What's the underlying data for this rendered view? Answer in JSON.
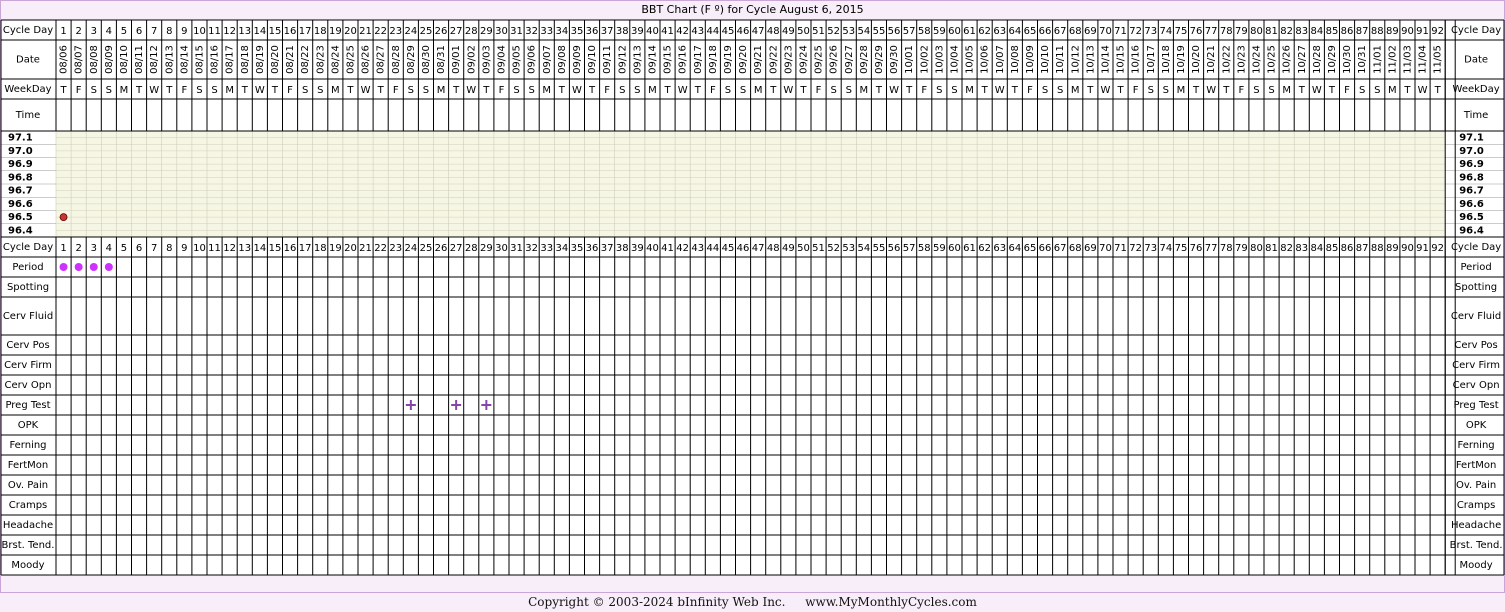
{
  "title": "BBT Chart (F º) for Cycle August 6, 2015",
  "labels": {
    "cycle_day": "Cycle Day",
    "date": "Date",
    "weekday": "WeekDay",
    "time": "Time"
  },
  "symptom_rows": [
    "Period",
    "Spotting",
    "Cerv Fluid",
    "Cerv Pos",
    "Cerv Firm",
    "Cerv Opn",
    "Preg Test",
    "OPK",
    "Ferning",
    "FertMon",
    "Ov. Pain",
    "Cramps",
    "Headache",
    "Brst. Tend.",
    "Moody"
  ],
  "weekdays": [
    "T",
    "F",
    "S",
    "S",
    "M",
    "T",
    "W",
    "T",
    "F",
    "S",
    "S",
    "M",
    "T",
    "W",
    "T",
    "F",
    "S",
    "S",
    "M",
    "T",
    "W",
    "T",
    "F",
    "S",
    "S",
    "M",
    "T",
    "W",
    "T",
    "F",
    "S",
    "S",
    "M",
    "T",
    "W",
    "T",
    "F",
    "S",
    "S",
    "M",
    "T",
    "W",
    "T",
    "F",
    "S",
    "S",
    "M",
    "T",
    "W",
    "T",
    "F",
    "S",
    "S",
    "M",
    "T",
    "W",
    "T",
    "F",
    "S",
    "S",
    "M",
    "T",
    "W",
    "T",
    "F",
    "S",
    "S",
    "M",
    "T",
    "W",
    "T",
    "F",
    "S",
    "S",
    "M",
    "T",
    "W",
    "T",
    "F",
    "S",
    "S",
    "M",
    "T",
    "W",
    "T",
    "F",
    "S",
    "S",
    "M",
    "T",
    "W",
    "T"
  ],
  "dates": [
    "08/06",
    "08/07",
    "08/08",
    "08/09",
    "08/10",
    "08/11",
    "08/12",
    "08/13",
    "08/14",
    "08/15",
    "08/16",
    "08/17",
    "08/18",
    "08/19",
    "08/20",
    "08/21",
    "08/22",
    "08/23",
    "08/24",
    "08/25",
    "08/26",
    "08/27",
    "08/28",
    "08/29",
    "08/30",
    "08/31",
    "09/01",
    "09/02",
    "09/03",
    "09/04",
    "09/05",
    "09/06",
    "09/07",
    "09/08",
    "09/09",
    "09/10",
    "09/11",
    "09/12",
    "09/13",
    "09/14",
    "09/15",
    "09/16",
    "09/17",
    "09/18",
    "09/19",
    "09/20",
    "09/21",
    "09/22",
    "09/23",
    "09/24",
    "09/25",
    "09/26",
    "09/27",
    "09/28",
    "09/29",
    "09/30",
    "10/01",
    "10/02",
    "10/03",
    "10/04",
    "10/05",
    "10/06",
    "10/07",
    "10/08",
    "10/09",
    "10/10",
    "10/11",
    "10/12",
    "10/13",
    "10/14",
    "10/15",
    "10/16",
    "10/17",
    "10/18",
    "10/19",
    "10/20",
    "10/21",
    "10/22",
    "10/23",
    "10/24",
    "10/25",
    "10/26",
    "10/27",
    "10/28",
    "10/29",
    "10/30",
    "10/31",
    "11/01",
    "11/02",
    "11/03",
    "11/04",
    "11/05"
  ],
  "chart_data": {
    "type": "scatter",
    "title": "BBT Chart (F º) for Cycle August 6, 2015",
    "x_label": "Cycle Day",
    "x_range": [
      1,
      92
    ],
    "y_range": [
      96.4,
      97.1
    ],
    "y_ticks": [
      "97.1",
      "97.0",
      "96.9",
      "96.8",
      "96.7",
      "96.6",
      "96.5",
      "96.4"
    ],
    "temperatures": [
      {
        "day": 1,
        "value": 96.5
      }
    ],
    "period_days": [
      1,
      2,
      3,
      4
    ],
    "preg_test_days": [
      24,
      27,
      29
    ],
    "colors": {
      "temperature_point": "#cc3333",
      "period_dot": "#cc33ff",
      "preg_test_mark": "#8844aa",
      "temp_area": "#f6f6e4",
      "page_background": "#f7eefa"
    }
  },
  "footer": {
    "copyright": "Copyright © 2003-2024 bInfinity Web Inc.",
    "site": "www.MyMonthlyCycles.com"
  }
}
